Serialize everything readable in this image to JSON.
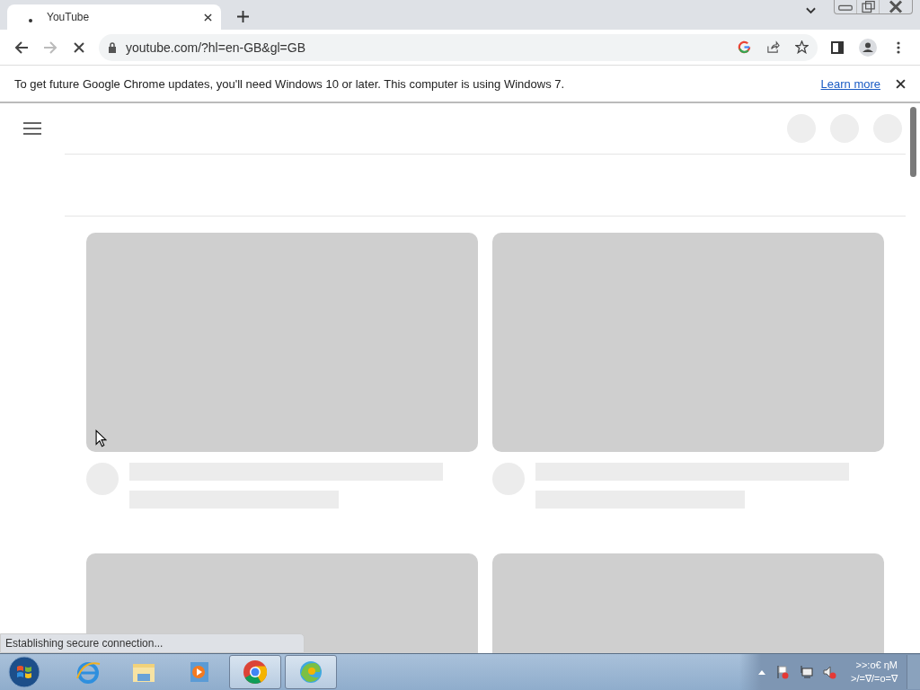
{
  "tabs": [
    {
      "title": "YouTube",
      "selected": true
    }
  ],
  "toolbar": {
    "url": "youtube.com/?hl=en-GB&gl=GB",
    "loading": true
  },
  "infobar": {
    "message": "To get future Google Chrome updates, you'll need Windows 10 or later. This computer is using Windows 7.",
    "link": "Learn more"
  },
  "feed": {
    "placeholders": [
      {
        "kind": "skeleton"
      },
      {
        "kind": "skeleton"
      },
      {
        "kind": "thumbnail"
      },
      {
        "kind": "thumbnail"
      }
    ]
  },
  "status_bubble": "Establishing secure connection...",
  "taskbar": {
    "apps": [
      {
        "kind": "ie",
        "active": false
      },
      {
        "kind": "explorer",
        "active": false
      },
      {
        "kind": "media",
        "active": false
      },
      {
        "kind": "chrome",
        "active": true
      },
      {
        "kind": "edge",
        "active": true
      }
    ],
    "clock": [
      ">>:o€ ηM",
      ">/=∇/=o=∇"
    ]
  }
}
